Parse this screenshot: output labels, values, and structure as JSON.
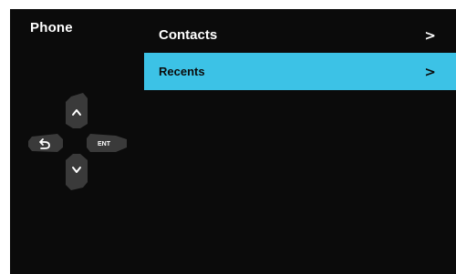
{
  "header": {
    "title": "Phone"
  },
  "menu": {
    "items": [
      {
        "label": "Contacts",
        "chevron": ">",
        "selected": false
      },
      {
        "label": "Recents",
        "chevron": ">",
        "selected": true
      }
    ]
  },
  "dpad": {
    "up_icon": "chevron-up-icon",
    "down_icon": "chevron-down-icon",
    "back_icon": "back-arrow-icon",
    "enter_label": "ENT"
  },
  "colors": {
    "background": "#0b0b0b",
    "selection": "#3cc2e6",
    "text": "#ffffff",
    "dpad": "#3a3a3a"
  }
}
